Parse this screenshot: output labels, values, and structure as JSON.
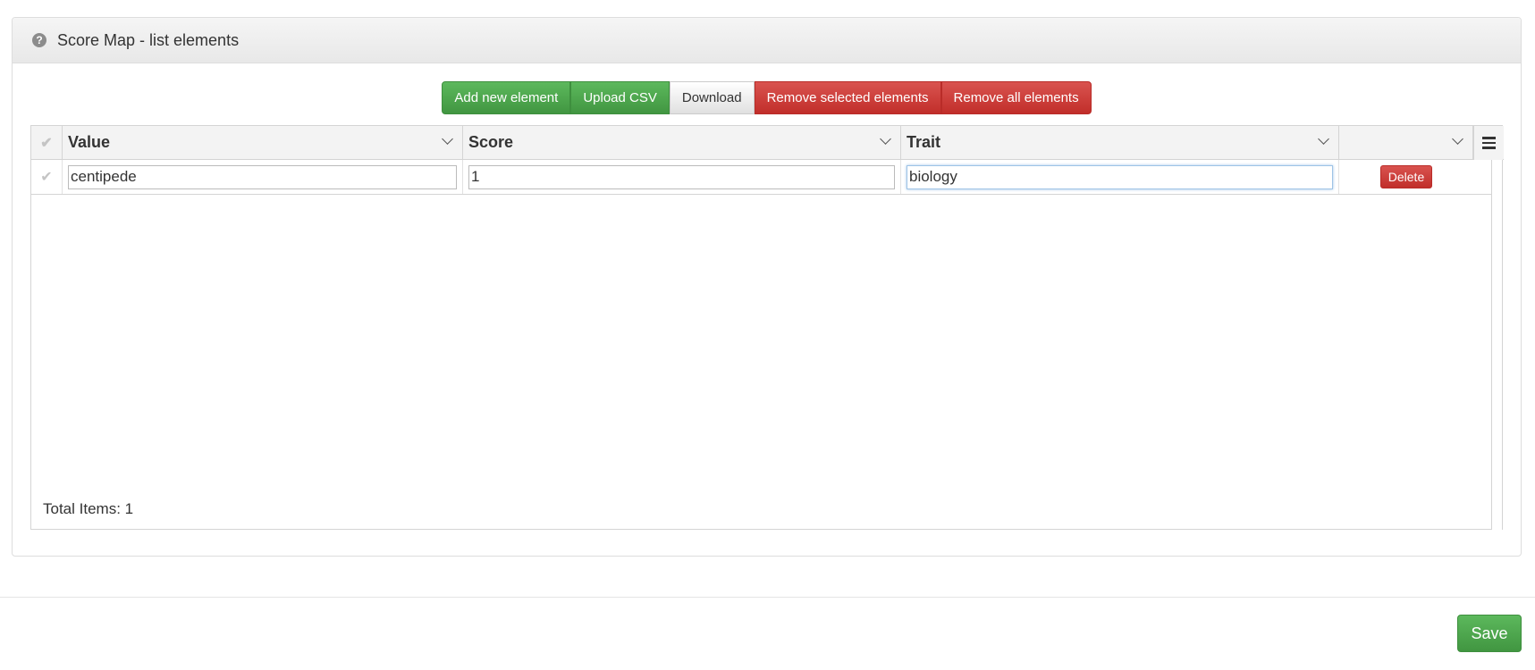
{
  "panel": {
    "title": "Score Map - list elements",
    "help_icon": "question-circle-icon"
  },
  "toolbar": {
    "add_label": "Add new element",
    "upload_label": "Upload CSV",
    "download_label": "Download",
    "remove_selected_label": "Remove selected elements",
    "remove_all_label": "Remove all elements"
  },
  "grid": {
    "columns": [
      {
        "label": "Value"
      },
      {
        "label": "Score"
      },
      {
        "label": "Trait"
      },
      {
        "label": ""
      }
    ],
    "rows": [
      {
        "value": "centipede",
        "score": "1",
        "trait": "biology",
        "delete_label": "Delete"
      }
    ],
    "footer": "Total Items: 1"
  },
  "save_label": "Save",
  "colors": {
    "success": "#5cb85c",
    "danger": "#d9534f",
    "header_bg": "#f3f3f3"
  }
}
